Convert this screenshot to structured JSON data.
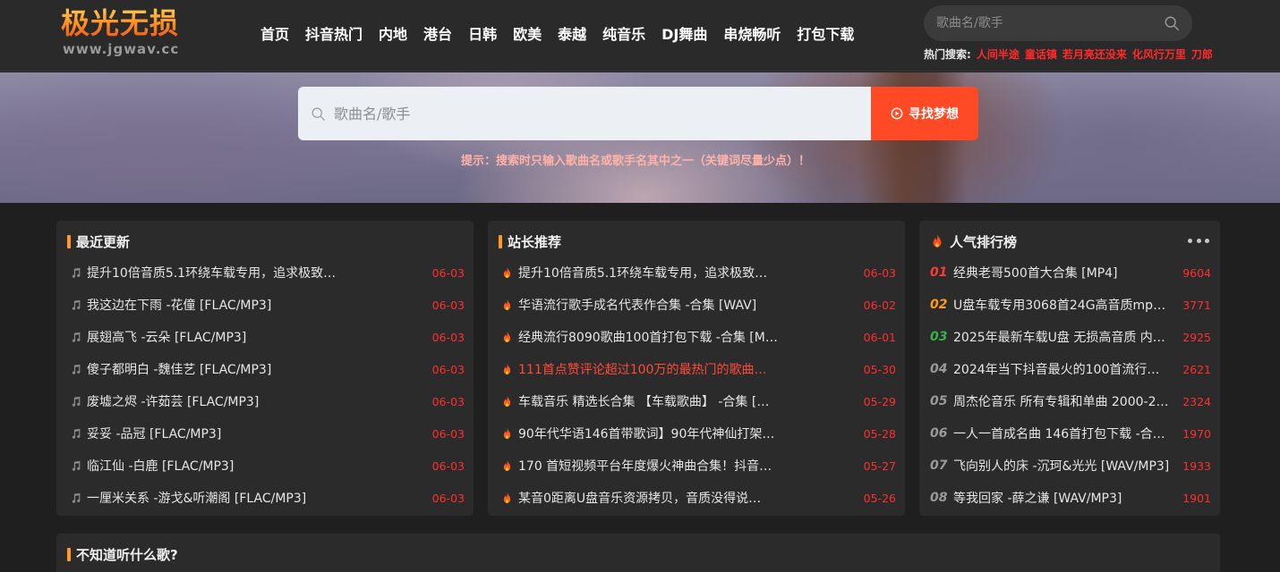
{
  "header": {
    "logo_main": "极光无损",
    "logo_sub": "www.jgwav.cc",
    "nav": [
      "首页",
      "抖音热门",
      "内地",
      "港台",
      "日韩",
      "欧美",
      "泰越",
      "纯音乐",
      "DJ舞曲",
      "串烧畅听",
      "打包下载"
    ],
    "search_placeholder": "歌曲名/歌手",
    "hot_label": "热门搜索:",
    "hot_keywords": [
      "人间半途",
      "童话镇",
      "若月亮还没来",
      "化风行万里",
      "刀郎"
    ]
  },
  "banner": {
    "search_placeholder": "歌曲名/歌手",
    "button_label": "寻找梦想",
    "tip": "提示：搜索时只输入歌曲名或歌手名其中之一（关键词尽量少点）！"
  },
  "recent": {
    "title": "最近更新",
    "items": [
      {
        "text": "提升10倍音质5.1环绕车载专用，追求极致…",
        "date": "06-03"
      },
      {
        "text": "我这边在下雨 -花僮 [FLAC/MP3]",
        "date": "06-03"
      },
      {
        "text": "展翅高飞 -云朵 [FLAC/MP3]",
        "date": "06-03"
      },
      {
        "text": "傻子都明白 -魏佳艺 [FLAC/MP3]",
        "date": "06-03"
      },
      {
        "text": "废墟之烬 -许茹芸 [FLAC/MP3]",
        "date": "06-03"
      },
      {
        "text": "妥妥 -品冠 [FLAC/MP3]",
        "date": "06-03"
      },
      {
        "text": "临江仙 -白鹿 [FLAC/MP3]",
        "date": "06-03"
      },
      {
        "text": "一厘米关系 -游戈&听潮阁 [FLAC/MP3]",
        "date": "06-03"
      }
    ]
  },
  "recommend": {
    "title": "站长推荐",
    "items": [
      {
        "text": "提升10倍音质5.1环绕车载专用，追求极致…",
        "date": "06-03"
      },
      {
        "text": "华语流行歌手成名代表作合集 -合集 [WAV]",
        "date": "06-02"
      },
      {
        "text": "经典流行8090歌曲100首打包下载 -合集 [M…",
        "date": "06-01"
      },
      {
        "text": "111首点赞评论超过100万的最热门的歌曲…",
        "date": "05-30"
      },
      {
        "text": "车载音乐 精选长合集 【车载歌曲】 -合集 […",
        "date": "05-29"
      },
      {
        "text": "90年代华语146首带歌词】90年代神仙打架…",
        "date": "05-28"
      },
      {
        "text": "170 首短视频平台年度爆火神曲合集！抖音…",
        "date": "05-27"
      },
      {
        "text": "某音0距离U盘音乐资源拷贝，音质没得说…",
        "date": "05-26"
      }
    ]
  },
  "ranking": {
    "title": "人气排行榜",
    "items": [
      {
        "rank": "01",
        "text": "经典老哥500首大合集 [MP4]",
        "count": "9604"
      },
      {
        "rank": "02",
        "text": "U盘车载专用3068首24G高音质mp…",
        "count": "3771"
      },
      {
        "rank": "03",
        "text": "2025年最新车载U盘 无损高音质 内…",
        "count": "2925"
      },
      {
        "rank": "04",
        "text": "2024年当下抖音最火的100首流行…",
        "count": "2621"
      },
      {
        "rank": "05",
        "text": "周杰伦音乐 所有专辑和单曲 2000-2…",
        "count": "2324"
      },
      {
        "rank": "06",
        "text": "一人一首成名曲 146首打包下载 -合…",
        "count": "1970"
      },
      {
        "rank": "07",
        "text": "飞向别人的床 -沉珂&光光 [WAV/MP3]",
        "count": "1933"
      },
      {
        "rank": "08",
        "text": "等我回家 -薛之谦 [WAV/MP3]",
        "count": "1901"
      }
    ]
  },
  "suggest": {
    "title": "不知道听什么歌?"
  },
  "colors": {
    "accent": "#ff4a25",
    "title_bar": "#ff9a1a",
    "date_red": "#ff2e2e",
    "rank1": "#ff3b30",
    "rank2": "#ff9a1a",
    "rank3": "#33b34a"
  }
}
